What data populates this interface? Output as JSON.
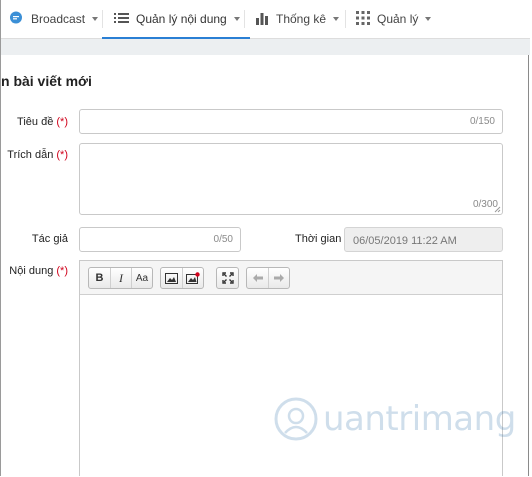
{
  "nav": {
    "items": [
      {
        "label": "Broadcast",
        "icon": "chat-bubble-icon"
      },
      {
        "label": "Quản lý nội dung",
        "icon": "list-icon",
        "active": true
      },
      {
        "label": "Thống kê",
        "icon": "bar-chart-icon"
      },
      {
        "label": "Quản lý",
        "icon": "grid-icon"
      }
    ]
  },
  "page": {
    "title": "n bài viết mới"
  },
  "form": {
    "title_label": "Tiêu đề",
    "title_counter": "0/150",
    "excerpt_label": "Trích dẫn",
    "excerpt_counter": "0/300",
    "author_label": "Tác giả",
    "author_counter": "0/50",
    "time_label": "Thời gian",
    "time_value": "06/05/2019 11:22 AM",
    "content_label": "Nội dung",
    "required_mark": "(*)"
  },
  "editor": {
    "toolbar": {
      "bold": "B",
      "italic": "I",
      "font_size": "Aa"
    }
  },
  "watermark": {
    "text": "uantrimang"
  },
  "colors": {
    "accent": "#2a7fd4",
    "required": "#d0021b"
  }
}
